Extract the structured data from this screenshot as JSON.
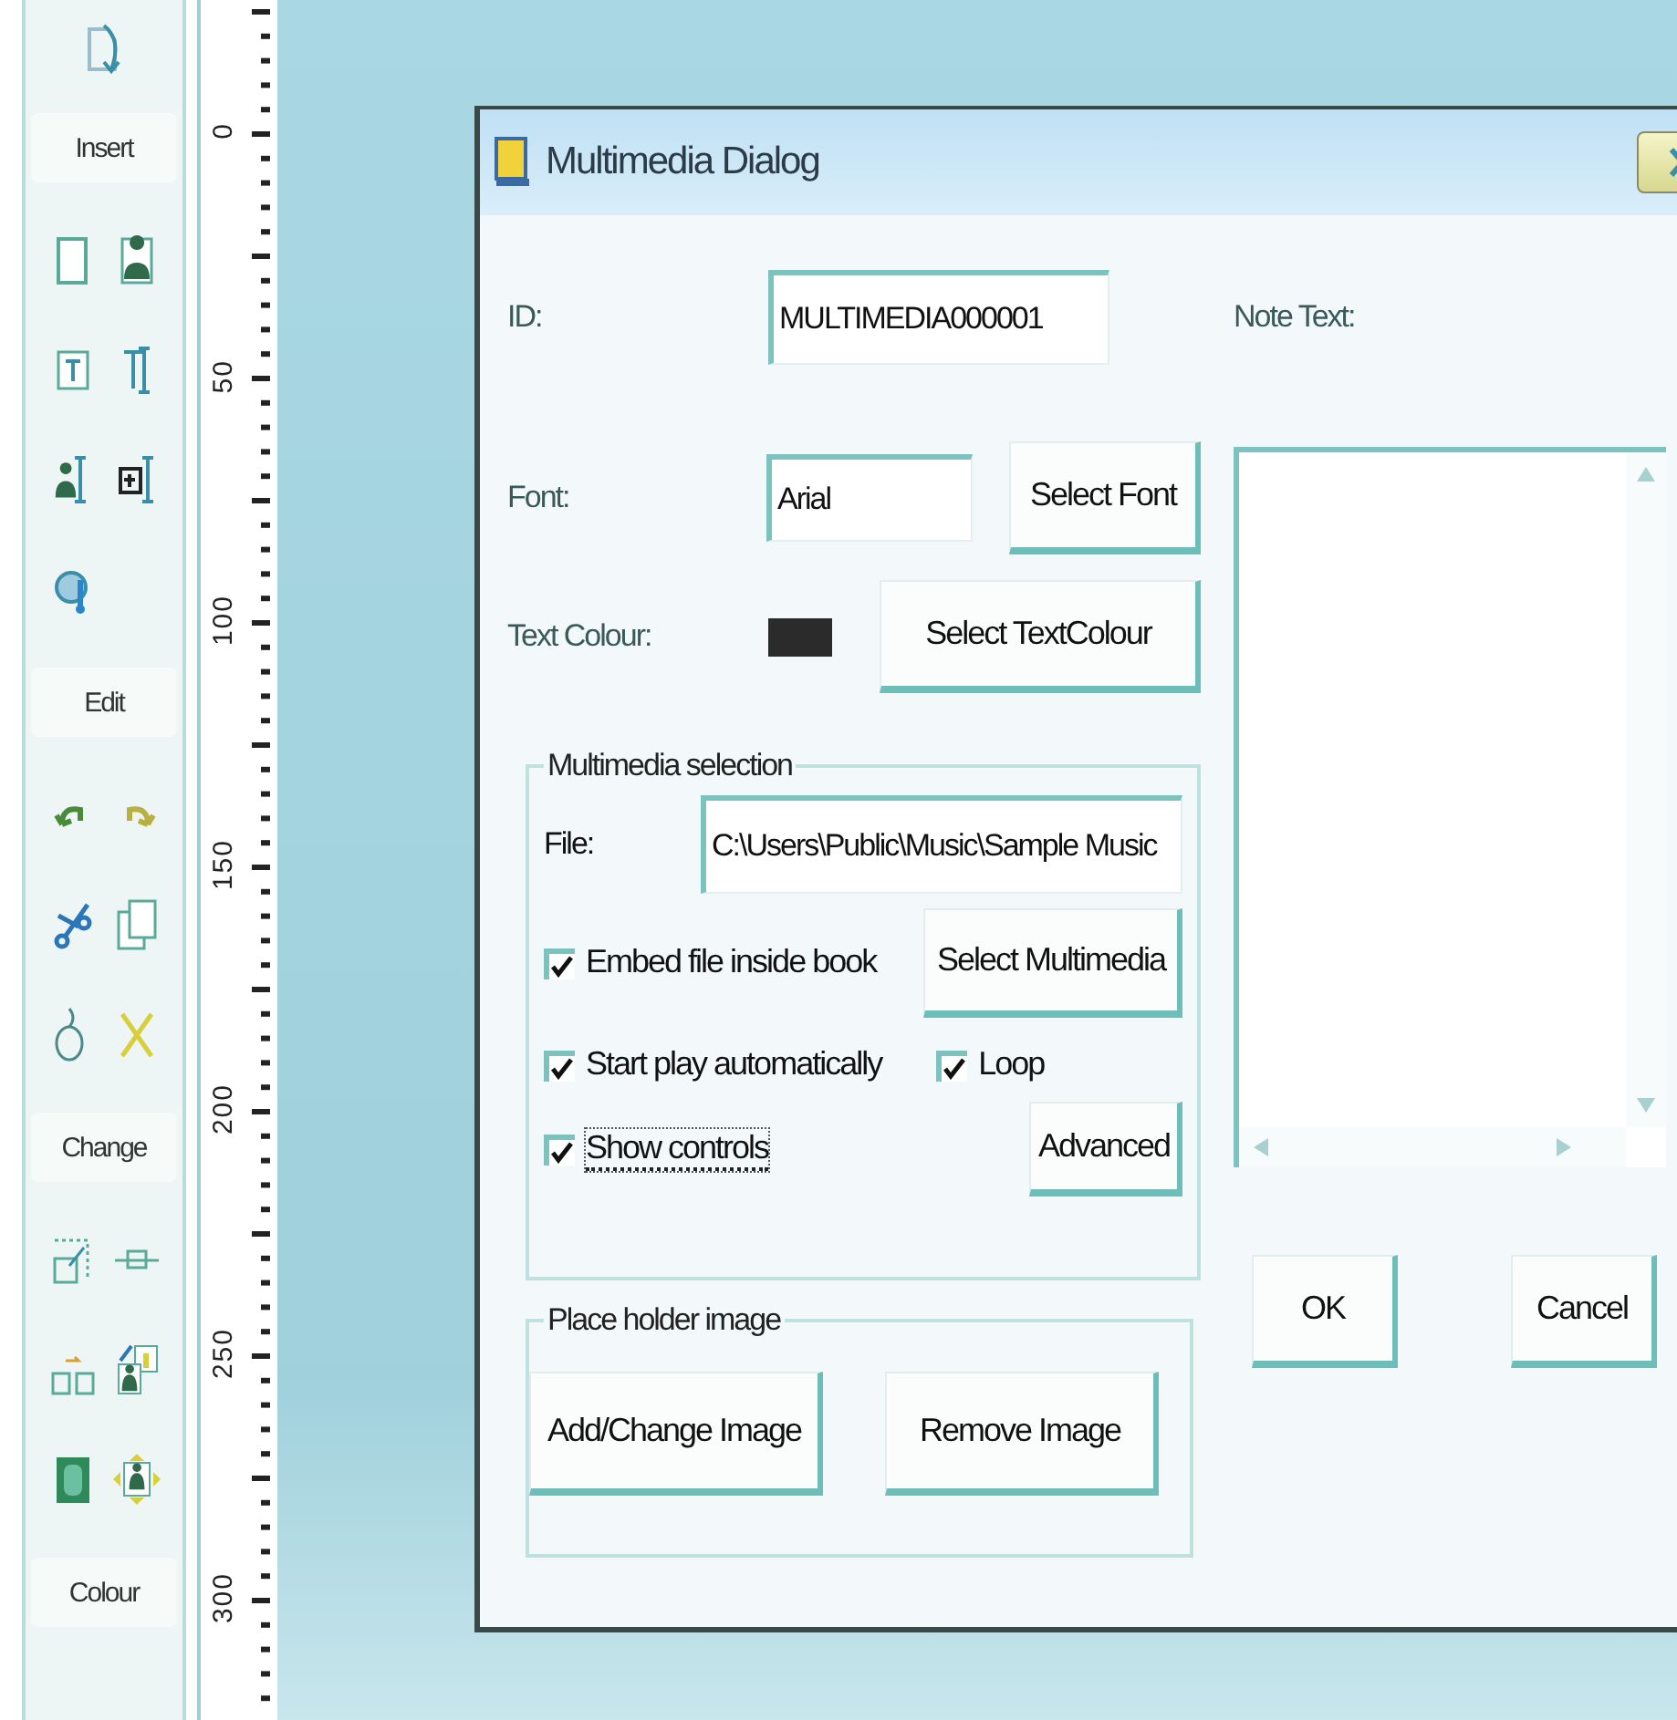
{
  "toolbar": {
    "sections": [
      {
        "title": "Insert"
      },
      {
        "title": "Edit"
      },
      {
        "title": "Change"
      },
      {
        "title": "Colour"
      }
    ]
  },
  "ruler": {
    "labels": [
      "0",
      "50",
      "100",
      "150",
      "200",
      "250",
      "300"
    ]
  },
  "dialog": {
    "title": "Multimedia Dialog",
    "id": {
      "label": "ID:",
      "value": "MULTIMEDIA000001"
    },
    "font": {
      "label": "Font:",
      "value": "Arial",
      "button": "Select Font"
    },
    "text_colour": {
      "label": "Text Colour:",
      "color": "#2b2b2b",
      "button": "Select TextColour"
    },
    "multimedia_selection": {
      "title": "Multimedia selection",
      "file_label": "File:",
      "file_value": "C:\\Users\\Public\\Music\\Sample Music",
      "checkboxes": [
        {
          "label": "Embed file inside book",
          "checked": true,
          "focused": false
        },
        {
          "label": "Start play automatically",
          "checked": true,
          "focused": false
        },
        {
          "label": "Loop",
          "checked": true,
          "focused": false
        },
        {
          "label": "Show controls",
          "checked": true,
          "focused": true
        }
      ],
      "select_button": "Select Multimedia",
      "advanced_button": "Advanced"
    },
    "placeholder_image": {
      "title": "Place holder image",
      "buttons": [
        "Add/Change Image",
        "Remove Image"
      ]
    },
    "note_text": {
      "label": "Note Text:"
    },
    "buttons": [
      "OK",
      "Cancel"
    ]
  }
}
